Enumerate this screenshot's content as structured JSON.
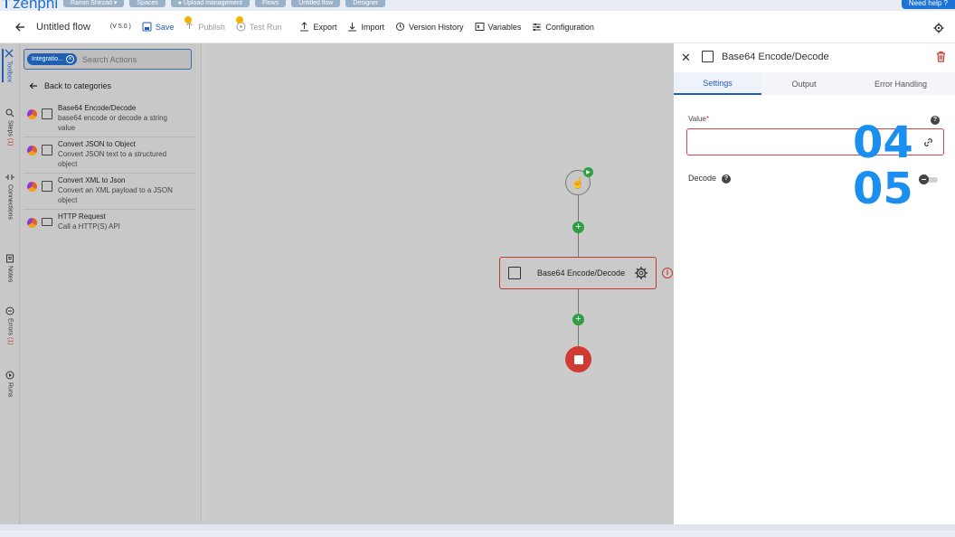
{
  "app": {
    "logo_text": "zenphi",
    "need_help": "Need help ?"
  },
  "breadcrumbs": [
    "Ramin Shirzad",
    "Spaces",
    "Upload management",
    "Flows",
    "Untitled flow",
    "Designer"
  ],
  "toolbar": {
    "title": "Untitled flow",
    "version": "(V 5.0 )",
    "save": "Save",
    "publish": "Publish",
    "test_run": "Test Run",
    "export": "Export",
    "import": "Import",
    "version_history": "Version History",
    "variables": "Variables",
    "configuration": "Configuration"
  },
  "rail": {
    "toolbox": "Toolbox",
    "steps": "Steps",
    "steps_count": "(1)",
    "connections": "Connections",
    "notes": "Notes",
    "errors": "Errors",
    "errors_count": "(1)",
    "runs": "Runs"
  },
  "toolbox": {
    "filter_chip": "Integratio...",
    "search_placeholder": "Search Actions",
    "back_to_categories": "Back to categories",
    "actions": [
      {
        "name": "Base64 Encode/Decode",
        "desc": "base64 encode or decode a string value"
      },
      {
        "name": "Convert JSON to Object",
        "desc": "Convert JSON text to a structured object"
      },
      {
        "name": "Convert XML to Json",
        "desc": "Convert an XML payload to a JSON object"
      },
      {
        "name": "HTTP Request",
        "desc": "Call a HTTP(S) API"
      }
    ]
  },
  "canvas": {
    "step_label": "Base64 Encode/Decode"
  },
  "panel": {
    "title": "Base64 Encode/Decode",
    "tabs": [
      "Settings",
      "Output",
      "Error Handling"
    ],
    "value_label": "Value",
    "required_mark": "*",
    "value_input": "",
    "decode_label": "Decode",
    "decode_on": false
  },
  "annotations": [
    "04",
    "05"
  ],
  "colors": {
    "accent": "#1e5fb4",
    "error": "#d03a30",
    "success": "#2f9e44",
    "annotation": "#1a8ff0"
  }
}
